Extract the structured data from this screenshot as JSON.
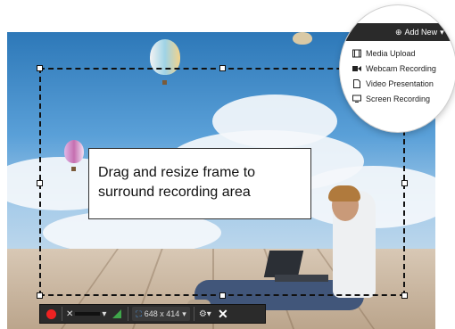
{
  "callout": {
    "text": "Drag and resize frame to surround recording area"
  },
  "toolbar": {
    "resolution": "648 x 414"
  },
  "add_new": {
    "label": "Add New",
    "items": [
      {
        "label": "Media Upload",
        "icon": "film-icon"
      },
      {
        "label": "Webcam Recording",
        "icon": "camera-icon"
      },
      {
        "label": "Video Presentation",
        "icon": "document-icon"
      },
      {
        "label": "Screen Recording",
        "icon": "monitor-icon"
      }
    ]
  },
  "colors": {
    "record": "#e22222",
    "toolbar_bg": "#2b2b2b",
    "menu_header_bg": "#2a2a2a"
  }
}
